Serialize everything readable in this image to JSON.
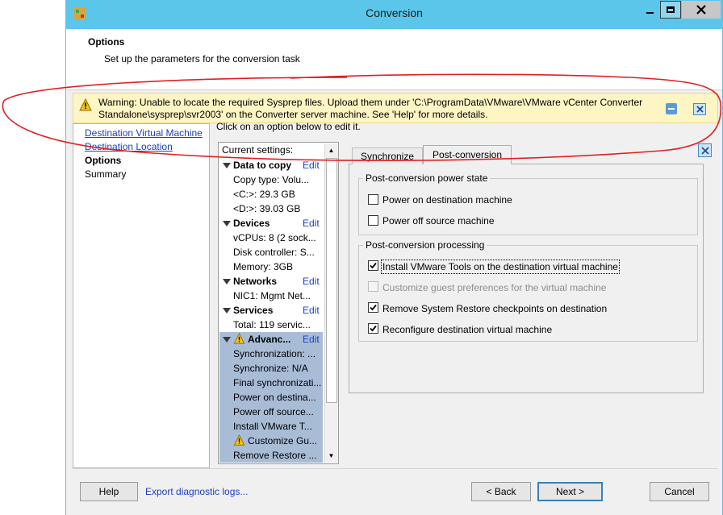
{
  "window": {
    "title": "Conversion"
  },
  "header": {
    "title": "Options",
    "subtitle": "Set up the parameters for the conversion task"
  },
  "warning": {
    "text": "Warning: Unable to locate the required Sysprep files. Upload them under 'C:\\ProgramData\\VMware\\VMware vCenter Converter Standalone\\sysprep\\svr2003' on the Converter server machine. See 'Help' for more details."
  },
  "nav": {
    "items": [
      {
        "label": "Destination Virtual Machine"
      },
      {
        "label": "Destination Location"
      },
      {
        "label": "Options"
      },
      {
        "label": "Summary"
      }
    ]
  },
  "hint": "Click on an option below to edit it.",
  "tree": {
    "header": "Current settings:",
    "edit_label": "Edit",
    "data_to_copy": {
      "title": "Data to copy",
      "items": [
        "Copy type: Volu...",
        "<C:>: 29.3 GB",
        "<D:>: 39.03 GB"
      ]
    },
    "devices": {
      "title": "Devices",
      "items": [
        "vCPUs: 8 (2 sock...",
        "Disk controller: S...",
        "Memory: 3GB"
      ]
    },
    "networks": {
      "title": "Networks",
      "items": [
        "NIC1: Mgmt Net..."
      ]
    },
    "services": {
      "title": "Services",
      "items": [
        "Total: 119 servic..."
      ]
    },
    "advanced": {
      "title": "Advanc...",
      "items": [
        "Synchronization: ...",
        "Synchronize: N/A",
        "Final synchronizati...",
        "Power on destina...",
        "Power off source...",
        "Install VMware T...",
        "Customize Gu...",
        "Remove Restore ..."
      ]
    }
  },
  "tabs": {
    "synchronize": "Synchronize",
    "post_conversion": "Post-conversion"
  },
  "power_state": {
    "legend": "Post-conversion power state",
    "power_on": {
      "label": "Power on destination machine",
      "checked": false
    },
    "power_off": {
      "label": "Power off source machine",
      "checked": false
    }
  },
  "processing": {
    "legend": "Post-conversion processing",
    "install_tools": {
      "label": "Install VMware Tools on the destination virtual machine",
      "checked": true
    },
    "customize": {
      "label": "Customize guest preferences for the virtual machine",
      "checked": false,
      "disabled": true
    },
    "remove_restore": {
      "label": "Remove System Restore checkpoints on destination",
      "checked": true
    },
    "reconfigure": {
      "label": "Reconfigure destination virtual machine",
      "checked": true
    }
  },
  "footer": {
    "help": "Help",
    "export": "Export diagnostic logs...",
    "back": "< Back",
    "next": "Next >",
    "cancel": "Cancel"
  },
  "colors": {
    "titlebar": "#5cc6ea",
    "link": "#1a3fbf",
    "warning_bg": "#fdf5c3",
    "annotation": "#e02020"
  }
}
